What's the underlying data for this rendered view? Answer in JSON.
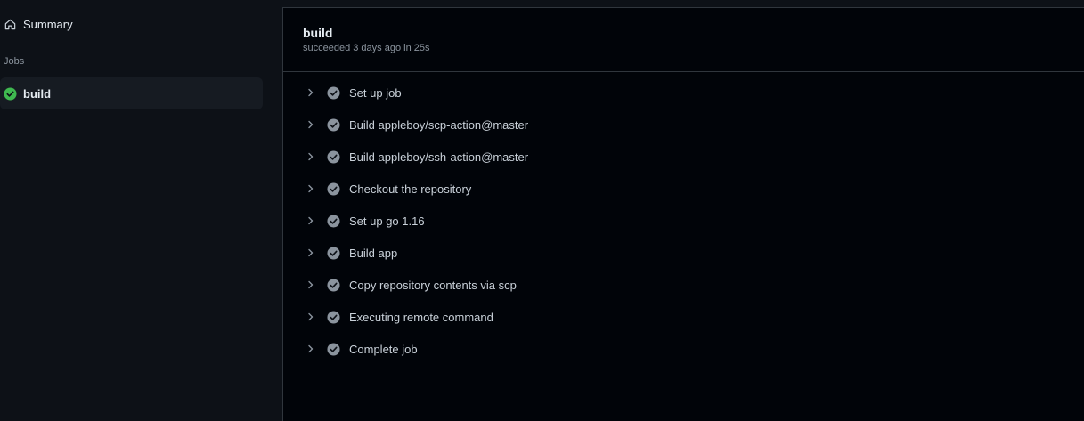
{
  "sidebar": {
    "summary_label": "Summary",
    "summary_icon": "home-icon",
    "jobs_heading": "Jobs",
    "jobs": [
      {
        "label": "build",
        "status_icon": "success-check-icon",
        "status_color": "#3fb950"
      }
    ]
  },
  "job": {
    "title": "build",
    "meta": "succeeded 3 days ago in 25s"
  },
  "steps": [
    {
      "label": "Set up job"
    },
    {
      "label": "Build appleboy/scp-action@master"
    },
    {
      "label": "Build appleboy/ssh-action@master"
    },
    {
      "label": "Checkout the repository"
    },
    {
      "label": "Set up go 1.16"
    },
    {
      "label": "Build app"
    },
    {
      "label": "Copy repository contents via scp"
    },
    {
      "label": "Executing remote command"
    },
    {
      "label": "Complete job"
    }
  ],
  "colors": {
    "success": "#3fb950",
    "step_check": "#8b949e"
  }
}
